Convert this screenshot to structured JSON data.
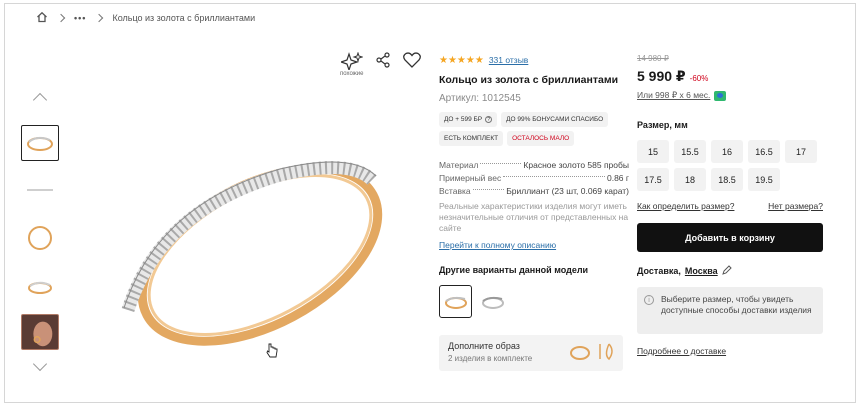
{
  "breadcrumb": {
    "ellipsis": "•••",
    "current": "Кольцо из золота с бриллиантами"
  },
  "toolbar": {
    "similar_label": "похожие"
  },
  "product": {
    "stars": "★★★★★",
    "reviews_link": "331 отзыв",
    "title": "Кольцо из золота с бриллиантами",
    "article": "Артикул: 1012545",
    "badges": [
      "ДО + 599 БР",
      "ДО 99% БОНУСАМИ СПАСИБО",
      "ЕСТЬ КОМПЛЕКТ",
      "ОСТАЛОСЬ МАЛО"
    ],
    "specs": [
      {
        "label": "Материал",
        "value": "Красное золото 585 пробы"
      },
      {
        "label": "Примерный вес",
        "value": "0.86 г"
      },
      {
        "label": "Вставка",
        "value": "Бриллиант (23 шт, 0.069 карат)"
      }
    ],
    "disclaimer": "Реальные характеристики изделия могут иметь незначительные отличия от представленных на сайте",
    "full_description_link": "Перейти к полному описанию",
    "variants_title": "Другие варианты данной модели",
    "complement_title": "Дополните образ",
    "complement_sub": "2 изделия в комплекте"
  },
  "price": {
    "old": "14 980 ₽",
    "current": "5 990 ₽",
    "discount": "-60%",
    "installment": "Или 998 ₽ х 6 мес."
  },
  "size": {
    "title": "Размер, мм",
    "options": [
      "15",
      "15.5",
      "16",
      "16.5",
      "17",
      "17.5",
      "18",
      "18.5",
      "19.5"
    ],
    "how_to_link": "Как определить размер?",
    "no_size_link": "Нет размера?"
  },
  "cart": {
    "add_label": "Добавить в корзину"
  },
  "delivery": {
    "label": "Доставка,",
    "city": "Москва",
    "note": "Выберите размер, чтобы увидеть доступные способы доставки изделия",
    "more_link": "Подробнее о доставке"
  },
  "colors": {
    "price_discount": "#d0021b",
    "link": "#2a6ea8",
    "star": "#f5a623",
    "gold": "#e0a35a",
    "cart_button": "#111111"
  }
}
